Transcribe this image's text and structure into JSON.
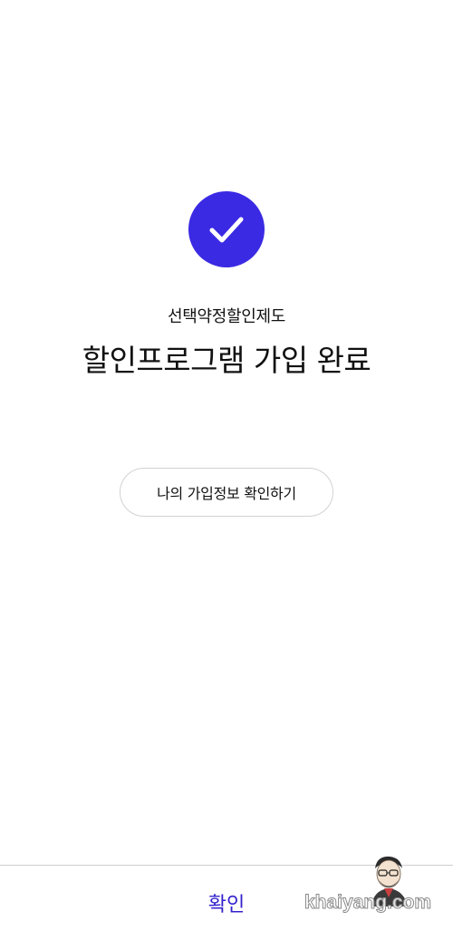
{
  "result": {
    "icon": "check-icon",
    "icon_color": "#3b2ae3",
    "subtitle": "선택약정할인제도",
    "title": "할인프로그램 가입 완료"
  },
  "info_button": {
    "label": "나의 가입정보 확인하기"
  },
  "footer": {
    "confirm_label": "확인",
    "confirm_color": "#3322cc"
  },
  "watermark": {
    "text": "khaiyang.com"
  }
}
